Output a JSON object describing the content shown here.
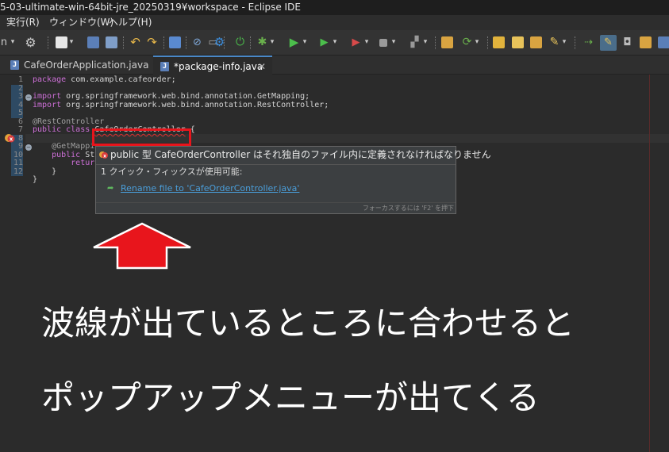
{
  "window": {
    "title": "5-03-ultimate-win-64bit-jre_20250319¥workspace - Eclipse IDE"
  },
  "menu": {
    "items": [
      "実行(R)",
      "ウィンドウ(W)",
      "ヘルプ(H)"
    ]
  },
  "toolbar": {
    "left_label": "n"
  },
  "tabs": [
    {
      "label": "CafeOrderApplication.java",
      "active": false
    },
    {
      "label": "*package-info.java",
      "active": true,
      "close": "✕"
    }
  ],
  "editor": {
    "line_numbers": [
      "1",
      "2",
      "3",
      "4",
      "5",
      "6",
      "7",
      "8",
      "9",
      "10",
      "11",
      "12"
    ],
    "lines": {
      "l1_kw": "package",
      "l1_rest": " com.example.cafeorder;",
      "l3_kw": "import",
      "l3_rest": " org.springframework.web.bind.annotation.GetMapping;",
      "l4_kw": "import",
      "l4_rest": " org.springframework.web.bind.annotation.RestController;",
      "l6": "@RestController",
      "l7_kw": "public class",
      "l7_space": " ",
      "l7_classname": "CafeOrderController",
      "l7_rest": " {",
      "l8": "    @GetMapping",
      "l9_kw": "    public",
      "l9_rest": " St",
      "l10_kw": "        return",
      "l11": "    }",
      "l12": "}"
    }
  },
  "popup": {
    "header": "public 型 CafeOrderController はそれ独自のファイル内に定義されなければなりません",
    "quickfix_count": "1 クイック・フィックスが使用可能:",
    "fix_label": "Rename file to 'CafeOrderController.java'",
    "footer": "フォーカスするには 'F2' を押下"
  },
  "caption": {
    "line1": "波線が出ているところに合わせると",
    "line2": "ポップアップメニューが出てくる"
  },
  "colors": {
    "annotation_red": "#e8151c",
    "link_blue": "#4a9eda",
    "background": "#2b2b2b"
  }
}
